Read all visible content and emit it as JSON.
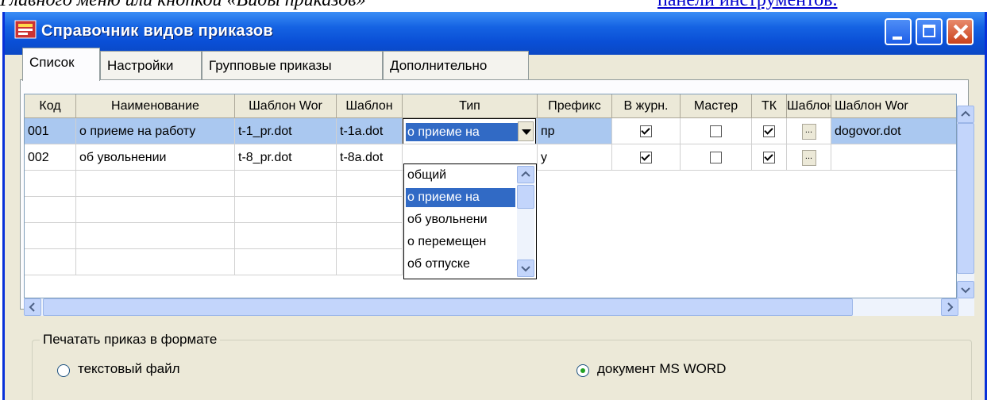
{
  "doc": {
    "top_text": "Главного меню или кнопкой «Виды приказов»",
    "top_link": "панели инструментов."
  },
  "window": {
    "title": "Справочник видов приказов",
    "colors": {
      "titlebar": "#0a4fd6",
      "selection": "#316ac5",
      "row_selected": "#aac8f0"
    }
  },
  "tabs": [
    "Список",
    "Настройки",
    "Групповые приказы",
    "Дополнительно"
  ],
  "grid": {
    "columns": [
      "Код",
      "Наименование",
      "Шаблон Wor",
      "Шаблон",
      "Тип",
      "Префикс",
      "В журн.",
      "Мастер",
      "ТК",
      "Шаблон",
      "Шаблон Wor"
    ],
    "rows": [
      {
        "code": "001",
        "name": "о приеме на работу",
        "tpl_word": "t-1_pr.dot",
        "tpl": "t-1a.dot",
        "type": "о приеме на",
        "prefix": "пр",
        "in_journal": true,
        "master": false,
        "tk": true,
        "tpl2_btn": "...",
        "tpl_word2": "dogovor.dot"
      },
      {
        "code": "002",
        "name": "об увольнении",
        "tpl_word": "t-8_pr.dot",
        "tpl": "t-8a.dot",
        "type": "",
        "prefix": "у",
        "in_journal": true,
        "master": false,
        "tk": true,
        "tpl2_btn": "...",
        "tpl_word2": ""
      }
    ],
    "type_options": [
      "общий",
      "о приеме на",
      "об увольнени",
      "о перемещен",
      "об отпуске"
    ],
    "type_selected_index": 1
  },
  "print_group": {
    "legend": "Печатать приказ в формате",
    "options": [
      {
        "label": "текстовый файл",
        "checked": false
      },
      {
        "label": "документ  MS WORD",
        "checked": true
      }
    ]
  }
}
